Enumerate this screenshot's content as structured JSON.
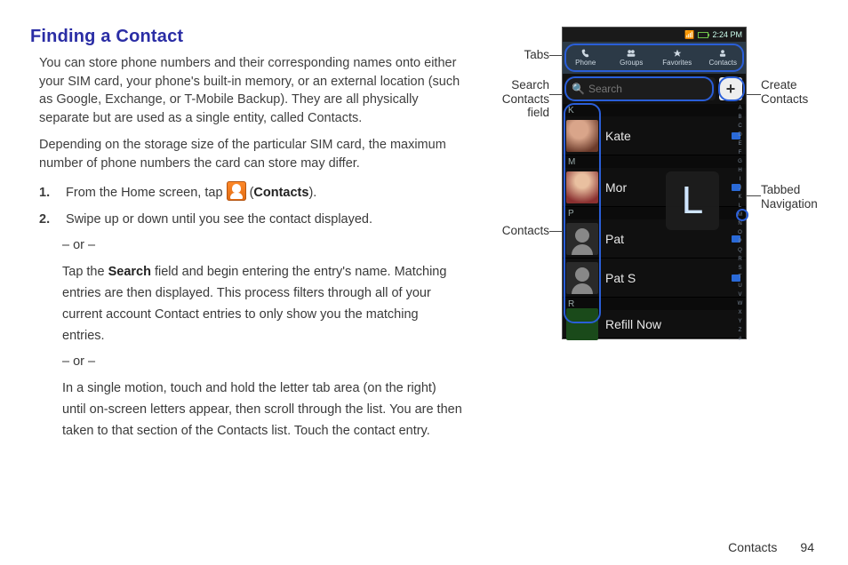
{
  "heading": "Finding a Contact",
  "para1": "You can store phone numbers and their corresponding names onto either your SIM card, your phone's built-in memory, or an external location (such as Google, Exchange, or T-Mobile Backup). They are all physically separate but are used as a single entity, called Contacts.",
  "para2": "Depending on the storage size of the particular SIM card, the maximum number of phone numbers the card can store may differ.",
  "steps": {
    "s1_pre": "From the Home screen, tap ",
    "s1_post_open": " (",
    "s1_bold": "Contacts",
    "s1_post_close": ").",
    "s2": "Swipe up or down until you see the contact displayed.",
    "or": "– or –",
    "s2b_a": "Tap the ",
    "s2b_bold": "Search",
    "s2b_b": " field and begin entering the entry's name. Matching entries are then displayed. This process filters through all of your current account Contact entries to only show you the matching entries.",
    "s2c": "In a single motion, touch and hold the letter tab area (on the right) until on-screen letters appear, then scroll through the list. You are then taken to that section of the Contacts list. Touch the contact entry."
  },
  "callouts": {
    "tabs": "Tabs",
    "search": "Search Contacts field",
    "contacts": "Contacts",
    "create": "Create Contacts",
    "tabnav": "Tabbed Navigation"
  },
  "phone": {
    "time": "2:24 PM",
    "tabs": [
      "Phone",
      "Groups",
      "Favorites",
      "Contacts"
    ],
    "search_placeholder": "Search",
    "big_letter": "L",
    "sections": [
      {
        "letter": "K",
        "rows": [
          "Kate"
        ]
      },
      {
        "letter": "M",
        "rows": [
          "Mor"
        ]
      },
      {
        "letter": "P",
        "rows": [
          "Pat",
          "Pat S"
        ]
      },
      {
        "letter": "R",
        "rows": [
          "Refill Now"
        ]
      }
    ],
    "index_rail": [
      "A",
      "B",
      "C",
      "D",
      "E",
      "F",
      "G",
      "H",
      "I",
      "J",
      "K",
      "L",
      "M",
      "N",
      "O",
      "P",
      "Q",
      "R",
      "S",
      "T",
      "U",
      "V",
      "W",
      "X",
      "Y",
      "Z",
      "#"
    ]
  },
  "footer": {
    "section": "Contacts",
    "page": "94"
  }
}
